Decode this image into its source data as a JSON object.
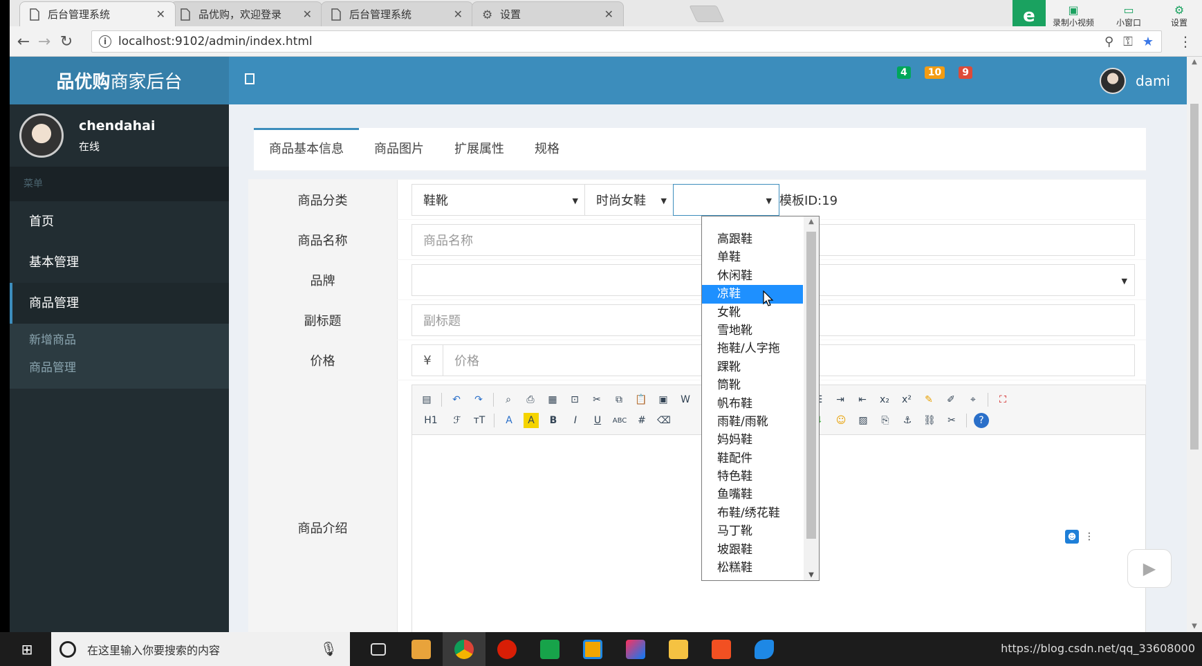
{
  "browser": {
    "tabs": [
      {
        "title": "后台管理系统",
        "active": true
      },
      {
        "title": "品优购，欢迎登录",
        "active": false
      },
      {
        "title": "后台管理系统",
        "active": false
      },
      {
        "title": "设置",
        "active": false
      }
    ],
    "url": "localhost:9102/admin/index.html",
    "extensions": {
      "record": "录制小视频",
      "window": "小窗口",
      "settings": "设置"
    }
  },
  "header": {
    "logo_bold": "品优购",
    "logo_rest": "商家后台",
    "badges": [
      "4",
      "10",
      "9"
    ],
    "username": "dami"
  },
  "sidebar": {
    "user": {
      "name": "chendahai",
      "status": "在线"
    },
    "menu_header": "菜单",
    "items": [
      {
        "label": "首页"
      },
      {
        "label": "基本管理"
      },
      {
        "label": "商品管理"
      }
    ],
    "subitems": [
      {
        "label": "新增商品"
      },
      {
        "label": "商品管理"
      }
    ]
  },
  "form": {
    "tabs": [
      "商品基本信息",
      "商品图片",
      "扩展属性",
      "规格"
    ],
    "labels": {
      "category": "商品分类",
      "name": "商品名称",
      "brand": "品牌",
      "subtitle": "副标题",
      "price": "价格",
      "intro": "商品介绍"
    },
    "category": {
      "level1": "鞋靴",
      "level2": "时尚女鞋",
      "level3": ""
    },
    "template_id": "模板ID:19",
    "placeholders": {
      "name": "商品名称",
      "subtitle": "副标题",
      "price": "价格"
    },
    "currency": "¥",
    "editor_toolbar": {
      "heading": "H1",
      "font": "ℱ",
      "size": "ᴛT"
    }
  },
  "dropdown": {
    "options": [
      "高跟鞋",
      "单鞋",
      "休闲鞋",
      "凉鞋",
      "女靴",
      "雪地靴",
      "拖鞋/人字拖",
      "踝靴",
      "筒靴",
      "帆布鞋",
      "雨鞋/雨靴",
      "妈妈鞋",
      "鞋配件",
      "特色鞋",
      "鱼嘴鞋",
      "布鞋/绣花鞋",
      "马丁靴",
      "坡跟鞋",
      "松糕鞋"
    ],
    "highlighted": "凉鞋"
  },
  "taskbar": {
    "search_placeholder": "在这里输入你要搜索的内容",
    "tray_text": "https://blog.csdn.net/qq_33608000"
  },
  "colors": {
    "header": "#3c8dbc",
    "sidebar": "#222d32",
    "highlight": "#1e90ff"
  }
}
